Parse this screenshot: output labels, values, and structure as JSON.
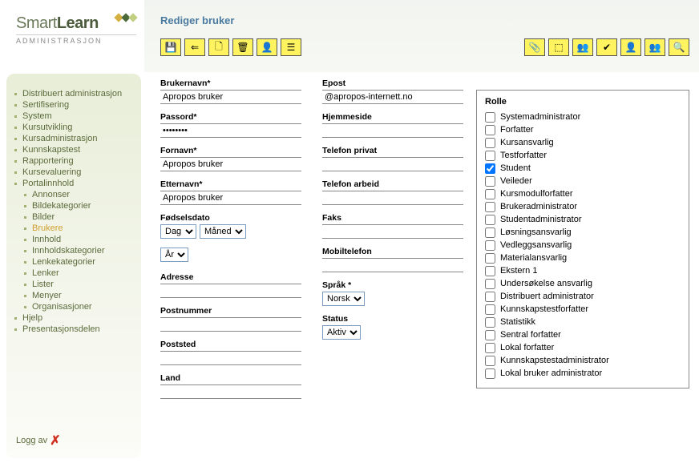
{
  "logo": {
    "text1": "Smart",
    "text2": "Learn",
    "sub": "ADMINISTRASJON"
  },
  "page_title": "Rediger bruker",
  "sidebar": {
    "items": [
      {
        "label": "Distribuert administrasjon",
        "sub": false
      },
      {
        "label": "Sertifisering",
        "sub": false
      },
      {
        "label": "System",
        "sub": false
      },
      {
        "label": "Kursutvikling",
        "sub": false
      },
      {
        "label": "Kursadministrasjon",
        "sub": false
      },
      {
        "label": "Kunnskapstest",
        "sub": false
      },
      {
        "label": "Rapportering",
        "sub": false
      },
      {
        "label": "Kursevaluering",
        "sub": false
      },
      {
        "label": "Portalinnhold",
        "sub": false
      },
      {
        "label": "Annonser",
        "sub": true
      },
      {
        "label": "Bildekategorier",
        "sub": true
      },
      {
        "label": "Bilder",
        "sub": true
      },
      {
        "label": "Brukere",
        "sub": true,
        "active": true
      },
      {
        "label": "Innhold",
        "sub": true
      },
      {
        "label": "Innholdskategorier",
        "sub": true
      },
      {
        "label": "Lenkekategorier",
        "sub": true
      },
      {
        "label": "Lenker",
        "sub": true
      },
      {
        "label": "Lister",
        "sub": true
      },
      {
        "label": "Menyer",
        "sub": true
      },
      {
        "label": "Organisasjoner",
        "sub": true
      },
      {
        "label": "Hjelp",
        "sub": false
      },
      {
        "label": "Presentasjonsdelen",
        "sub": false
      }
    ],
    "logout": "Logg av"
  },
  "toolbar_left": [
    {
      "name": "save-icon",
      "glyph": "💾"
    },
    {
      "name": "back-icon",
      "glyph": "⇐"
    },
    {
      "name": "new-icon",
      "glyph": "🗋"
    },
    {
      "name": "delete-icon",
      "glyph": "🗑"
    },
    {
      "name": "user-role-icon",
      "glyph": "👤"
    },
    {
      "name": "list-icon",
      "glyph": "☰"
    }
  ],
  "toolbar_right": [
    {
      "name": "attach-icon",
      "glyph": "📎"
    },
    {
      "name": "org-icon",
      "glyph": "⬚"
    },
    {
      "name": "stats-icon",
      "glyph": "👥"
    },
    {
      "name": "approve-icon",
      "glyph": "✔"
    },
    {
      "name": "course-user-icon",
      "glyph": "👤"
    },
    {
      "name": "group-icon",
      "glyph": "👥"
    },
    {
      "name": "search-icon",
      "glyph": "🔍"
    }
  ],
  "form": {
    "left": [
      {
        "key": "brukernavn",
        "label": "Brukernavn*",
        "value": "Apropos bruker",
        "type": "text"
      },
      {
        "key": "passord",
        "label": "Passord*",
        "value": "••••••••",
        "type": "password"
      },
      {
        "key": "fornavn",
        "label": "Fornavn*",
        "value": "Apropos bruker",
        "type": "text"
      },
      {
        "key": "etternavn",
        "label": "Etternavn*",
        "value": "Apropos bruker",
        "type": "text"
      },
      {
        "key": "fodselsdato",
        "label": "Fødselsdato",
        "type": "dob",
        "day": "Dag",
        "month": "Måned",
        "year": "År"
      },
      {
        "key": "adresse",
        "label": "Adresse",
        "value": "",
        "type": "text"
      },
      {
        "key": "postnummer",
        "label": "Postnummer",
        "value": "",
        "type": "text"
      },
      {
        "key": "poststed",
        "label": "Poststed",
        "value": "",
        "type": "text"
      },
      {
        "key": "land",
        "label": "Land",
        "value": "",
        "type": "text"
      }
    ],
    "right": [
      {
        "key": "epost",
        "label": "Epost",
        "value": "@apropos-internett.no",
        "type": "text"
      },
      {
        "key": "hjemmeside",
        "label": "Hjemmeside",
        "value": "",
        "type": "text"
      },
      {
        "key": "telefon_privat",
        "label": "Telefon privat",
        "value": "",
        "type": "text"
      },
      {
        "key": "telefon_arbeid",
        "label": "Telefon arbeid",
        "value": "",
        "type": "text"
      },
      {
        "key": "faks",
        "label": "Faks",
        "value": "",
        "type": "text"
      },
      {
        "key": "mobiltelefon",
        "label": "Mobiltelefon",
        "value": "",
        "type": "text"
      },
      {
        "key": "sprak",
        "label": "Språk *",
        "type": "select",
        "value": "Norsk"
      },
      {
        "key": "status",
        "label": "Status",
        "type": "select",
        "value": "Aktiv"
      }
    ]
  },
  "roles": {
    "title": "Rolle",
    "items": [
      {
        "label": "Systemadministrator",
        "checked": false
      },
      {
        "label": "Forfatter",
        "checked": false
      },
      {
        "label": "Kursansvarlig",
        "checked": false
      },
      {
        "label": "Testforfatter",
        "checked": false
      },
      {
        "label": "Student",
        "checked": true
      },
      {
        "label": "Veileder",
        "checked": false
      },
      {
        "label": "Kursmodulforfatter",
        "checked": false
      },
      {
        "label": "Brukeradministrator",
        "checked": false
      },
      {
        "label": "Studentadministrator",
        "checked": false
      },
      {
        "label": "Løsningsansvarlig",
        "checked": false
      },
      {
        "label": "Vedleggsansvarlig",
        "checked": false
      },
      {
        "label": "Materialansvarlig",
        "checked": false
      },
      {
        "label": "Ekstern 1",
        "checked": false
      },
      {
        "label": "Undersøkelse ansvarlig",
        "checked": false
      },
      {
        "label": "Distribuert administrator",
        "checked": false
      },
      {
        "label": "Kunnskapstestforfatter",
        "checked": false
      },
      {
        "label": "Statistikk",
        "checked": false
      },
      {
        "label": "Sentral forfatter",
        "checked": false
      },
      {
        "label": "Lokal forfatter",
        "checked": false
      },
      {
        "label": "Kunnskapstestadministrator",
        "checked": false
      },
      {
        "label": "Lokal bruker administrator",
        "checked": false
      }
    ]
  }
}
